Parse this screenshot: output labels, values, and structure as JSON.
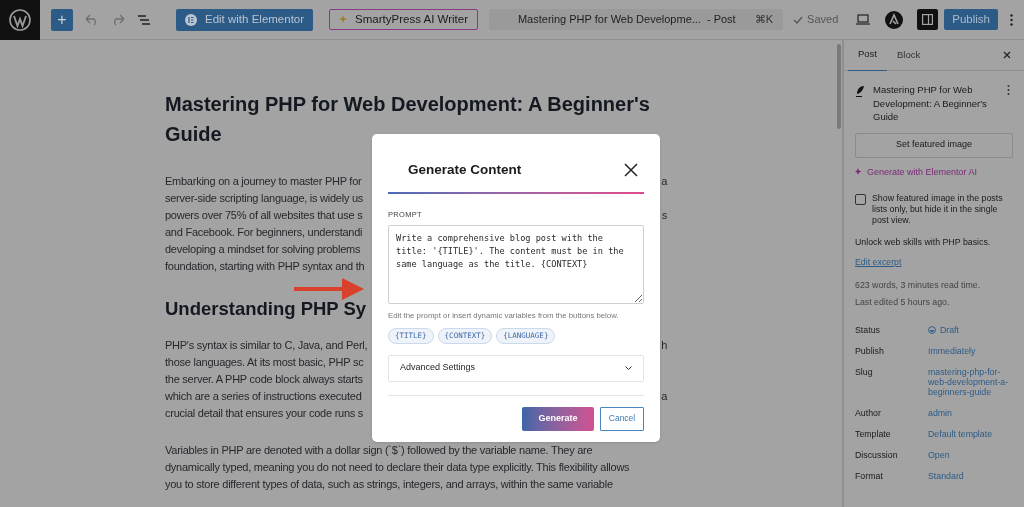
{
  "toolbar": {
    "add": "+",
    "elementor_button": "Edit with Elementor",
    "ai_button": "SmartyPress AI Writer",
    "command_bar": {
      "title": "Mastering PHP for Web Developme...",
      "suffix": "- Post",
      "shortcut": "⌘K"
    },
    "saved": "Saved",
    "publish": "Publish"
  },
  "editor": {
    "blocks": [
      {
        "kind": "title",
        "text": "Mastering PHP for Web Development: A Beginner's Guide"
      },
      {
        "kind": "paragraph",
        "lines": [
          {
            "text": "Embarking on a journey to master PHP for",
            "right": "a"
          },
          {
            "text": "server-side scripting language, is widely us"
          },
          {
            "text": "powers over 75% of all websites that use s",
            "right": "s"
          },
          {
            "text": "and Facebook. For beginners, understandi"
          },
          {
            "text": "developing a mindset for solving problems"
          },
          {
            "text": "foundation, starting with PHP syntax and th"
          }
        ]
      },
      {
        "kind": "heading",
        "text": "Understanding PHP Sy"
      },
      {
        "kind": "paragraph",
        "lines": [
          {
            "text": "PHP's syntax is similar to C, Java, and Perl,",
            "right": "h"
          },
          {
            "text": "those languages. At its most basic, PHP sc"
          },
          {
            "text": "the server. A PHP code block always starts"
          },
          {
            "text": "which are a series of instructions executed",
            "right": "a"
          },
          {
            "text": "crucial detail that ensures your code runs s"
          }
        ]
      },
      {
        "kind": "paragraph",
        "lines": [
          {
            "text": "Variables in PHP are denoted with a dollar sign (`$`) followed by the variable name. They are"
          },
          {
            "text": "dynamically typed, meaning you do not need to declare their data type explicitly. This flexibility allows"
          },
          {
            "text": "you to store different types of data, such as strings, integers, and arrays, within the same variable"
          }
        ]
      }
    ]
  },
  "modal": {
    "title": "Generate Content",
    "prompt_label": "PROMPT",
    "prompt_value": "Write a comprehensive blog post with the title: '{TITLE}'. The content must be in the same language as the title. {CONTEXT}",
    "hint": "Edit the prompt or insert dynamic variables from the buttons below.",
    "variables": [
      "{TITLE}",
      "{CONTEXT}",
      "{LANGUAGE}"
    ],
    "advanced": {
      "label": "Advanced Settings",
      "expanded": false
    },
    "generate": "Generate",
    "cancel": "Cancel"
  },
  "sidebar": {
    "tabs": [
      {
        "label": "Post",
        "selected": true
      },
      {
        "label": "Block",
        "selected": false
      }
    ],
    "post_title": "Mastering PHP for Web Development: A Beginner's Guide",
    "featured_button": "Set featured image",
    "ai_link": "Generate with Elementor AI",
    "checkbox": {
      "label": "Show featured image in the posts lists only, but hide it in the single post view.",
      "checked": false
    },
    "excerpt": "Unlock web skills with PHP basics.",
    "edit_excerpt": "Edit excerpt",
    "stats": [
      "623 words, 3 minutes read time.",
      "Last edited 5 hours ago."
    ],
    "fields": [
      {
        "label": "Status",
        "value": "Draft",
        "kind": "status"
      },
      {
        "label": "Publish",
        "value": "Immediately",
        "kind": "link"
      },
      {
        "label": "Slug",
        "value": "mastering-php-for-web-development-a-beginners-guide",
        "kind": "link"
      },
      {
        "label": "Author",
        "value": "admin",
        "kind": "link"
      },
      {
        "label": "Template",
        "value": "Default template",
        "kind": "link"
      },
      {
        "label": "Discussion",
        "value": "Open",
        "kind": "link"
      },
      {
        "label": "Format",
        "value": "Standard",
        "kind": "link"
      }
    ]
  }
}
